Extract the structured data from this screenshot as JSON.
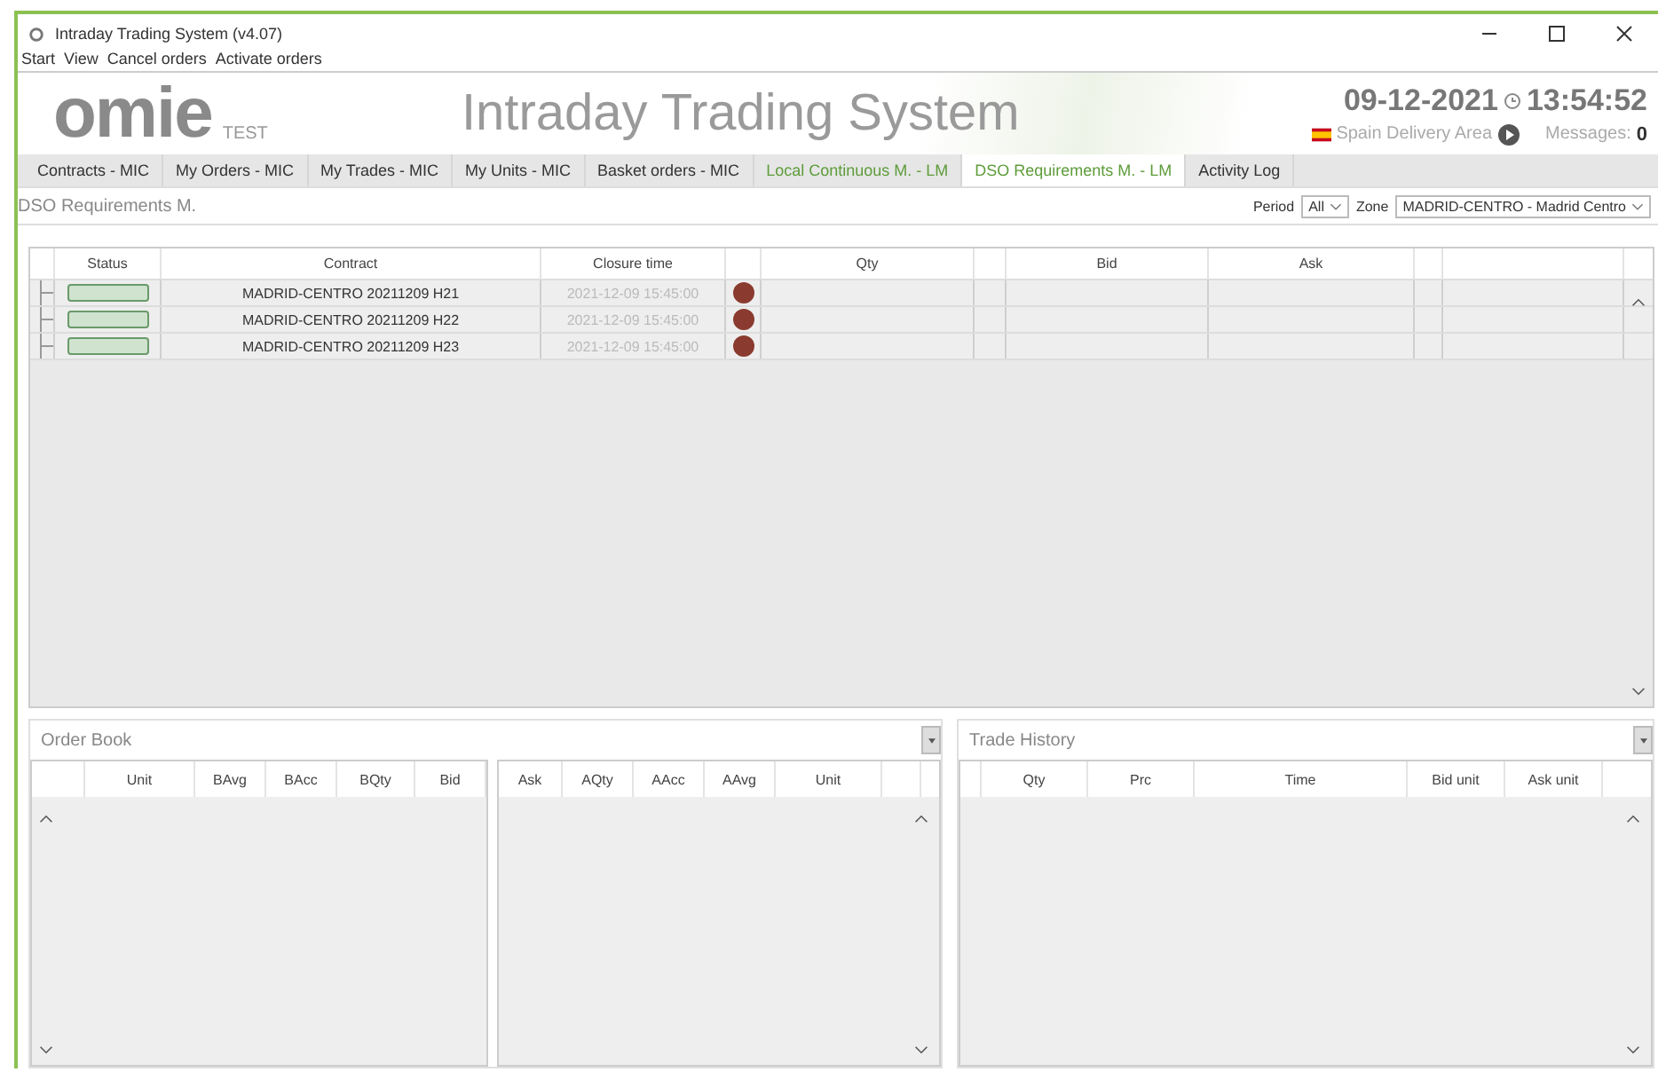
{
  "window": {
    "title": "Intraday Trading System (v4.07)"
  },
  "menu": [
    "Start",
    "View",
    "Cancel orders",
    "Activate orders"
  ],
  "header": {
    "logo": "omie",
    "logo_tag": "TEST",
    "app_name": "Intraday Trading System",
    "date": "09-12-2021",
    "time": "13:54:52",
    "delivery_area": "Spain Delivery Area",
    "messages_label": "Messages:",
    "messages_count": "0"
  },
  "tabs": [
    {
      "label": "Contracts - MIC",
      "selected": false,
      "color": "#333333"
    },
    {
      "label": "My Orders - MIC",
      "selected": false,
      "color": "#333333"
    },
    {
      "label": "My Trades  - MIC",
      "selected": false,
      "color": "#333333"
    },
    {
      "label": "My Units - MIC",
      "selected": false,
      "color": "#333333"
    },
    {
      "label": "Basket orders - MIC",
      "selected": false,
      "color": "#333333"
    },
    {
      "label": "Local Continuous M. - LM",
      "selected": false,
      "color": "#5e9c3a"
    },
    {
      "label": "DSO Requirements M. - LM",
      "selected": true,
      "color": "#5e9c3a"
    },
    {
      "label": "Activity Log",
      "selected": false,
      "color": "#333333"
    }
  ],
  "section_title": "DSO Requirements M.",
  "filters": {
    "period_label": "Period",
    "period_value": "All",
    "zone_label": "Zone",
    "zone_value": "MADRID-CENTRO - Madrid Centro"
  },
  "table": {
    "columns": [
      "Status",
      "Contract",
      "Closure time",
      "Qty",
      "Bid",
      "Ask"
    ],
    "rows": [
      {
        "contract": "MADRID-CENTRO 20211209 H21",
        "closure_time": "2021-12-09 15:45:00"
      },
      {
        "contract": "MADRID-CENTRO 20211209 H22",
        "closure_time": "2021-12-09 15:45:00"
      },
      {
        "contract": "MADRID-CENTRO 20211209 H23",
        "closure_time": "2021-12-09 15:45:00"
      }
    ]
  },
  "order_book": {
    "title": "Order Book",
    "bid_columns": [
      "Unit",
      "BAvg",
      "BAcc",
      "BQty",
      "Bid"
    ],
    "ask_columns": [
      "Ask",
      "AQty",
      "AAcc",
      "AAvg",
      "Unit"
    ]
  },
  "trade_history": {
    "title": "Trade History",
    "columns": [
      "Qty",
      "Prc",
      "Time",
      "Bid unit",
      "Ask unit"
    ]
  }
}
